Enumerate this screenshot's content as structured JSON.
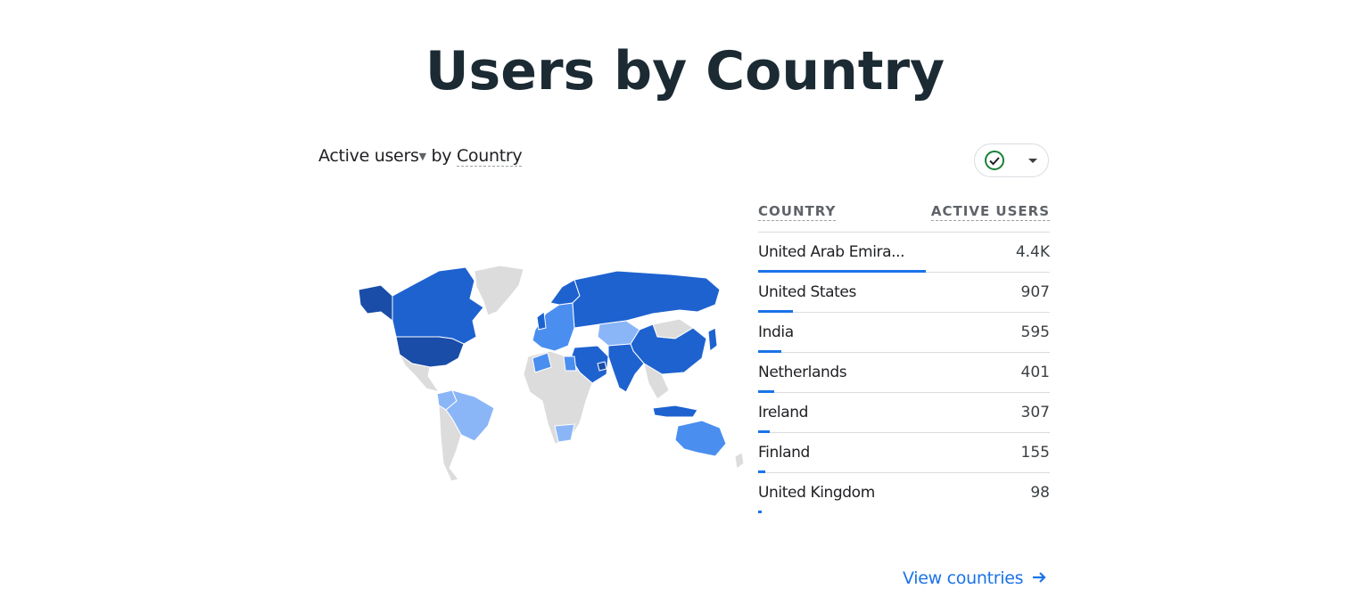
{
  "page_title": "Users by Country",
  "card": {
    "metric_label": "Active users",
    "by_text": "by",
    "dimension_label": "Country"
  },
  "table": {
    "headers": {
      "country": "COUNTRY",
      "users": "ACTIVE USERS"
    },
    "rows": [
      {
        "country": "United Arab Emira...",
        "value": "4.4K",
        "share": 0.575
      },
      {
        "country": "United States",
        "value": "907",
        "share": 0.12
      },
      {
        "country": "India",
        "value": "595",
        "share": 0.08
      },
      {
        "country": "Netherlands",
        "value": "401",
        "share": 0.055
      },
      {
        "country": "Ireland",
        "value": "307",
        "share": 0.04
      },
      {
        "country": "Finland",
        "value": "155",
        "share": 0.025
      },
      {
        "country": "United Kingdom",
        "value": "98",
        "share": 0.012
      }
    ]
  },
  "link": {
    "label": "View countries"
  },
  "icons": {
    "compare": "check-circle-icon",
    "dropdown": "caret-down-icon",
    "link": "arrow-right-icon"
  },
  "colors": {
    "darkest": "#1a4da8",
    "dark": "#1e62d0",
    "medium": "#4a8ef0",
    "light": "#8ab6f8",
    "none": "#dcdcdc",
    "accent": "#1a73e8",
    "check": "#188038"
  }
}
